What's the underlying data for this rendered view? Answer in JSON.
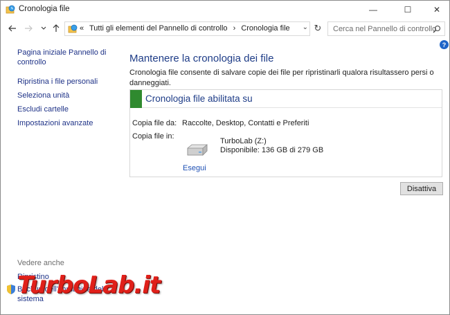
{
  "window": {
    "title": "Cronologia file",
    "controls": {
      "minimize": "—",
      "maximize": "☐",
      "close": "✕"
    }
  },
  "nav": {
    "back_icon": "arrow-left-icon",
    "forward_icon": "arrow-right-icon",
    "recent_icon": "chevron-down-icon",
    "up_icon": "arrow-up-icon",
    "address_prefix": "«",
    "breadcrumb": [
      "Tutti gli elementi del Pannello di controllo",
      "›",
      "Cronologia file"
    ],
    "search_placeholder": "Cerca nel Pannello di controllo"
  },
  "sidebar": {
    "items": [
      {
        "label": "Pagina iniziale Pannello di controllo"
      },
      {
        "label": "Ripristina i file personali"
      },
      {
        "label": "Seleziona unità"
      },
      {
        "label": "Escludi cartelle"
      },
      {
        "label": "Impostazioni avanzate"
      }
    ],
    "see_also_title": "Vedere anche",
    "see_also": [
      {
        "label": "Ripristino"
      },
      {
        "label": "Backup dell'immagine del sistema"
      }
    ]
  },
  "main": {
    "heading": "Mantenere la cronologia dei file",
    "description": "Cronologia file consente di salvare copie dei file per ripristinarli qualora risultassero persi o danneggiati.",
    "status": {
      "title": "Cronologia file abilitata su",
      "accent_color": "#2f8a2f",
      "copy_from_label": "Copia file da:",
      "copy_from_value": "Raccolte, Desktop, Contatti e Preferiti",
      "copy_to_label": "Copia file in:",
      "drive_name": "TurboLab (Z:)",
      "drive_free": "Disponibile: 136 GB di 279 GB",
      "run_label": "Esegui"
    },
    "disable_button": "Disattiva",
    "help": "?"
  },
  "watermark": "TurboLab.it",
  "colors": {
    "link": "#1e3287",
    "heading": "#1e3c87",
    "watermark": "#e0201a"
  }
}
